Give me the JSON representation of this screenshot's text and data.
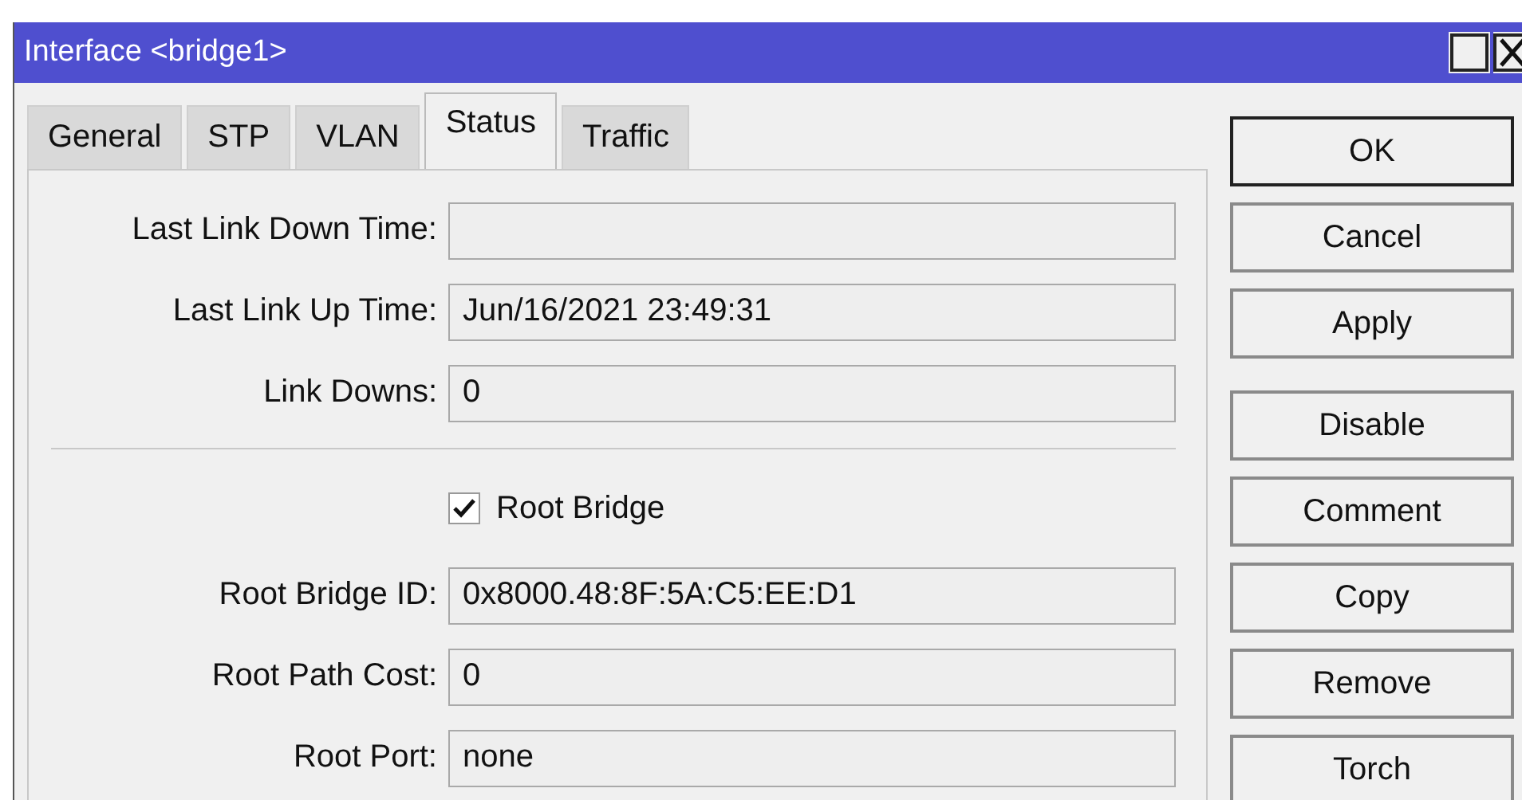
{
  "window": {
    "title": "Interface <bridge1>"
  },
  "tabs": [
    {
      "label": "General",
      "selected": false
    },
    {
      "label": "STP",
      "selected": false
    },
    {
      "label": "VLAN",
      "selected": false
    },
    {
      "label": "Status",
      "selected": true
    },
    {
      "label": "Traffic",
      "selected": false
    }
  ],
  "rows": [
    {
      "kind": "field",
      "label": "Last Link Down Time:"
    },
    {
      "kind": "field",
      "label": "Last Link Up Time:",
      "value": "Jun/16/2021 23:49:31"
    },
    {
      "kind": "field",
      "label": "Link Downs:",
      "value": "0"
    },
    {
      "kind": "separator"
    },
    {
      "kind": "checkbox",
      "label": "Root Bridge",
      "checked": true
    },
    {
      "kind": "field",
      "label": "Root Bridge ID:",
      "value": "0x8000.48:8F:5A:C5:EE:D1"
    },
    {
      "kind": "field",
      "label": "Root Path Cost:",
      "value": "0"
    },
    {
      "kind": "field",
      "label": "Root Port:",
      "value": "none"
    }
  ],
  "button_groups": [
    [
      "OK",
      "Cancel",
      "Apply"
    ],
    [
      "Disable",
      "Comment",
      "Copy",
      "Remove",
      "Torch"
    ]
  ]
}
